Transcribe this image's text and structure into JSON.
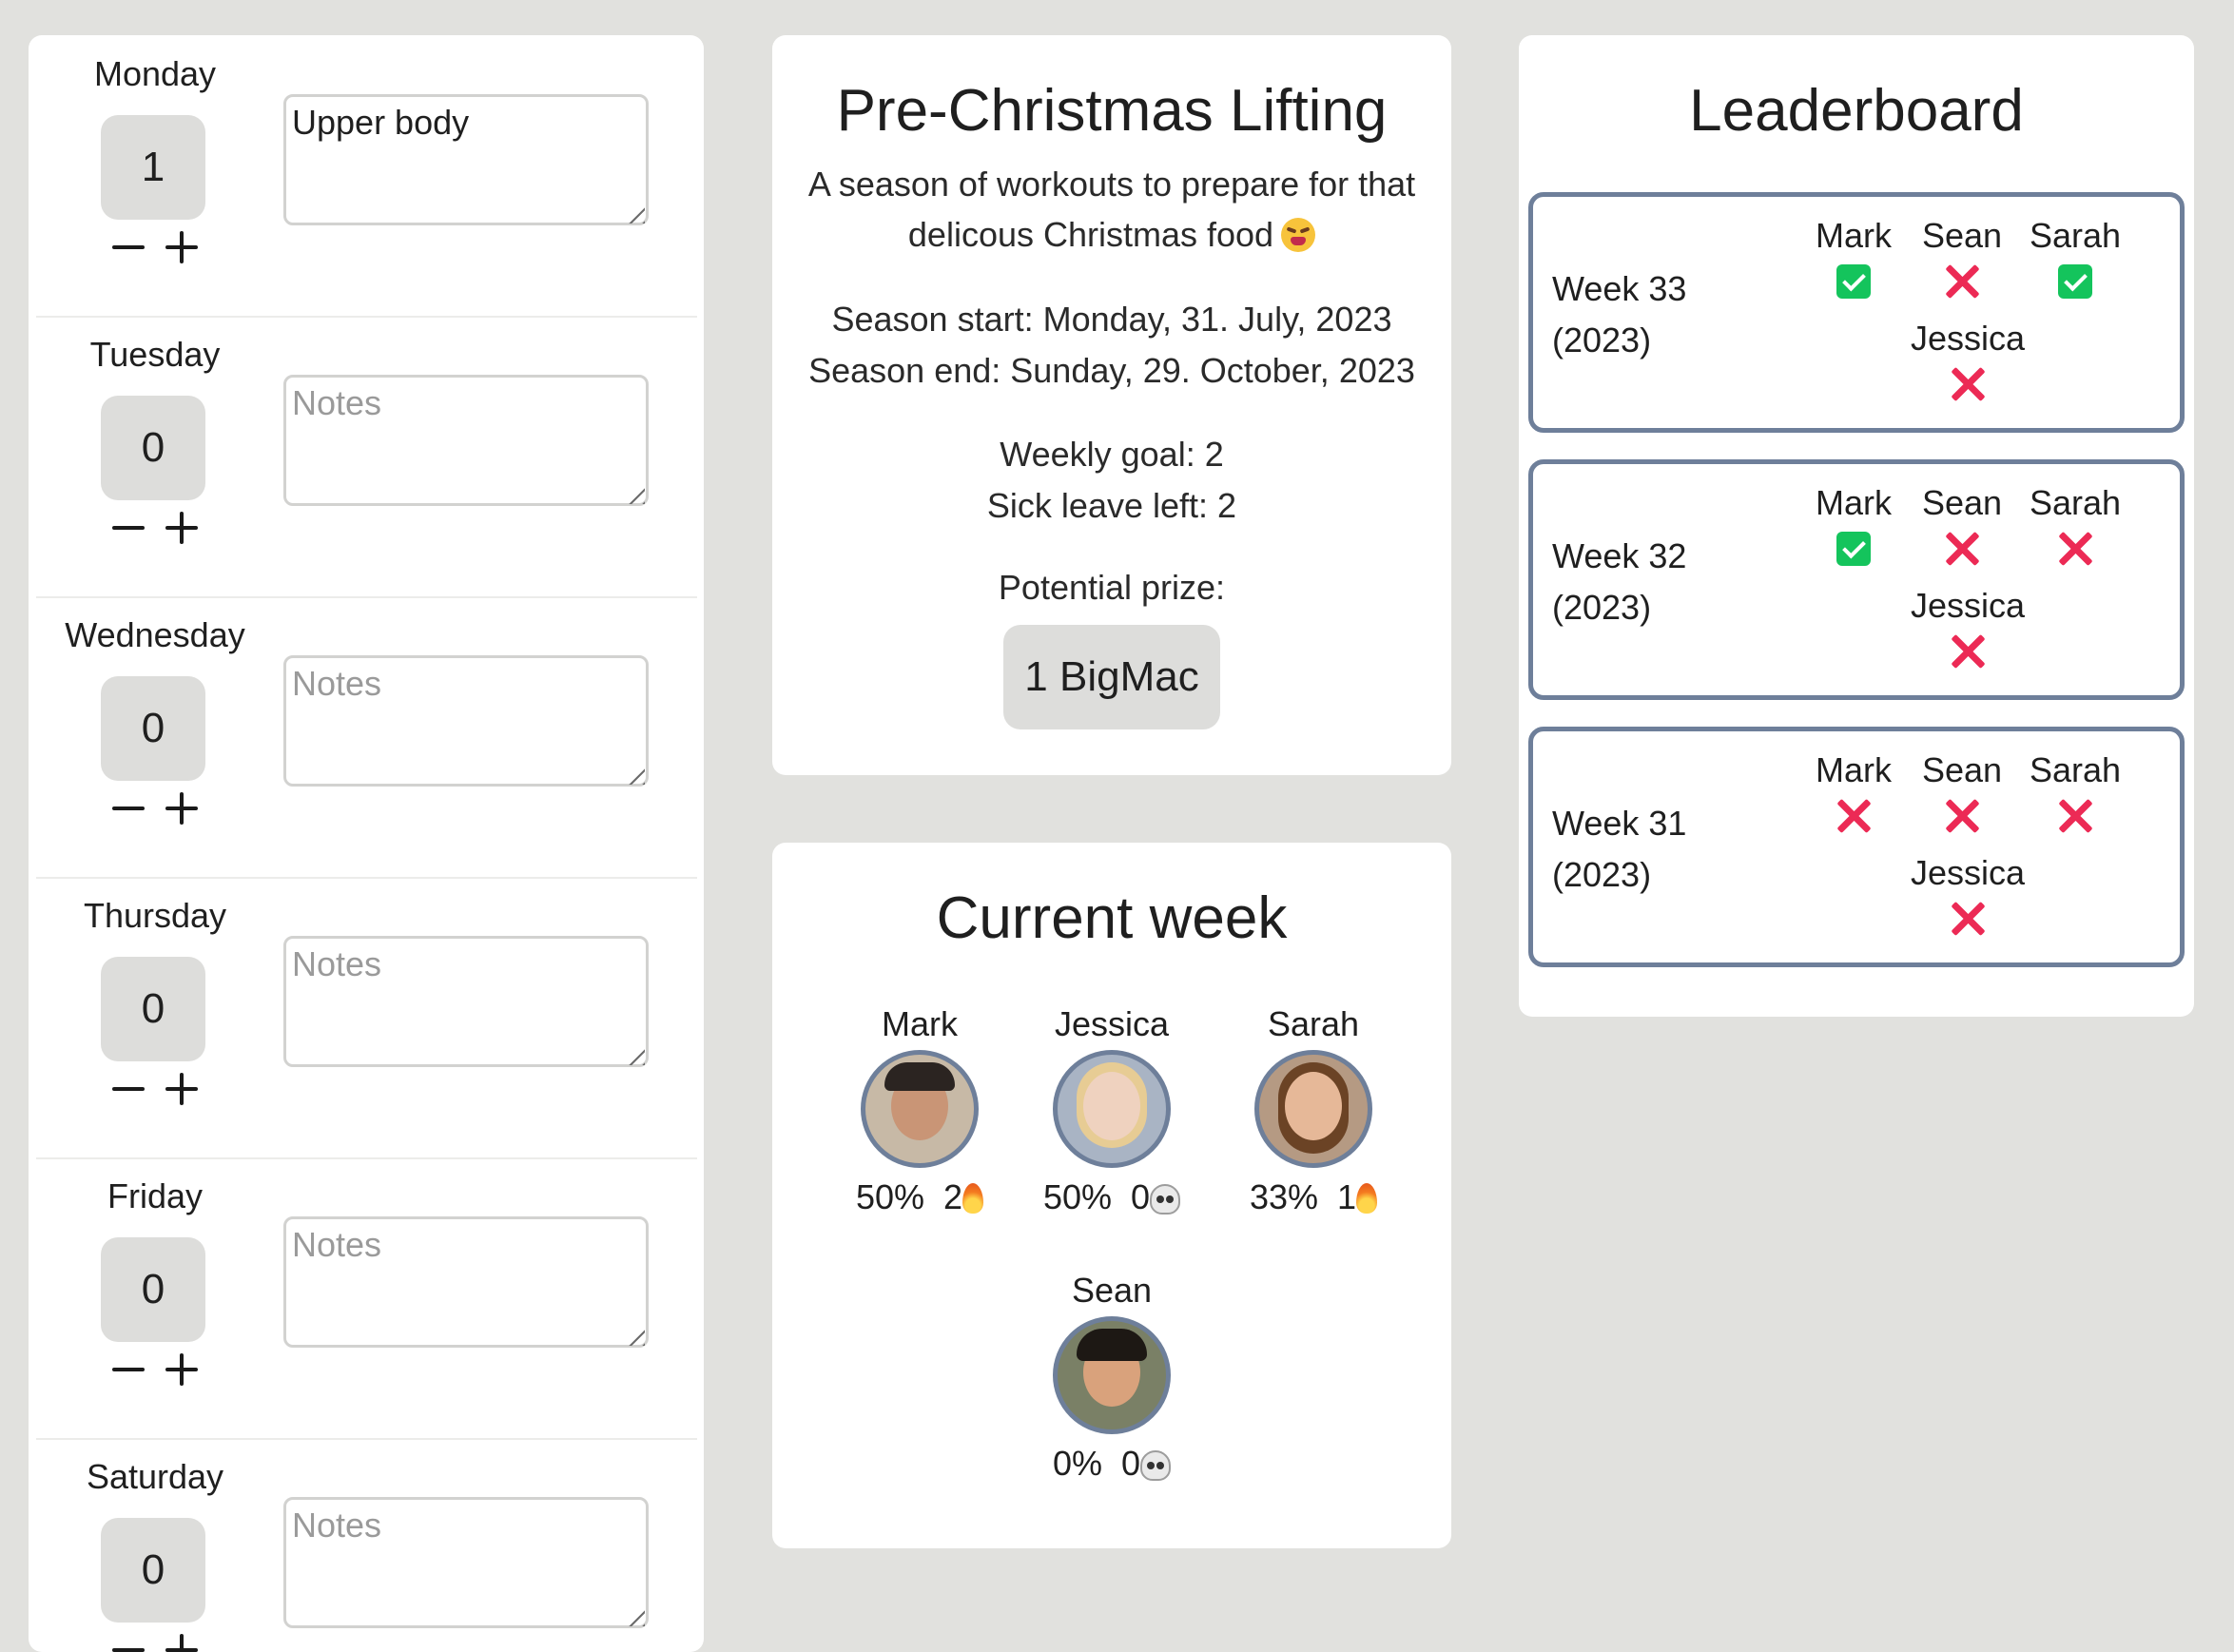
{
  "days": [
    {
      "name": "Monday",
      "count": "1",
      "notes_value": "Upper body",
      "notes_placeholder": "Notes"
    },
    {
      "name": "Tuesday",
      "count": "0",
      "notes_value": "",
      "notes_placeholder": "Notes"
    },
    {
      "name": "Wednesday",
      "count": "0",
      "notes_value": "",
      "notes_placeholder": "Notes"
    },
    {
      "name": "Thursday",
      "count": "0",
      "notes_value": "",
      "notes_placeholder": "Notes"
    },
    {
      "name": "Friday",
      "count": "0",
      "notes_value": "",
      "notes_placeholder": "Notes"
    },
    {
      "name": "Saturday",
      "count": "0",
      "notes_value": "",
      "notes_placeholder": "Notes"
    }
  ],
  "season": {
    "title": "Pre-Christmas Lifting",
    "description": "A season of workouts to prepare for that delicous Christmas food",
    "start": "Season start: Monday, 31. July, 2023",
    "end": "Season end: Sunday, 29. October, 2023",
    "weekly_goal_label": "Weekly goal: ",
    "weekly_goal_value": "2",
    "sick_leave_label": "Sick leave left: ",
    "sick_leave_value": "2",
    "prize_label": "Potential prize:",
    "prize_value": "1 BigMac"
  },
  "current_week": {
    "title": "Current week",
    "members": [
      {
        "name": "Mark",
        "percent": "50%",
        "streak": "2",
        "streak_icon": "flame-icon",
        "progress": 0.5
      },
      {
        "name": "Jessica",
        "percent": "50%",
        "streak": "0",
        "streak_icon": "skull-icon",
        "progress": 0.5
      },
      {
        "name": "Sarah",
        "percent": "33%",
        "streak": "1",
        "streak_icon": "flame-icon",
        "progress": 0.33
      },
      {
        "name": "Sean",
        "percent": "0%",
        "streak": "0",
        "streak_icon": "skull-icon",
        "progress": 0.0
      }
    ]
  },
  "leaderboard": {
    "title": "Leaderboard",
    "weeks": [
      {
        "week": "Week 33",
        "year": "(2023)",
        "results": [
          {
            "name": "Mark",
            "done": true
          },
          {
            "name": "Sean",
            "done": false
          },
          {
            "name": "Sarah",
            "done": true
          },
          {
            "name": "Jessica",
            "done": false
          }
        ]
      },
      {
        "week": "Week 32",
        "year": "(2023)",
        "results": [
          {
            "name": "Mark",
            "done": true
          },
          {
            "name": "Sean",
            "done": false
          },
          {
            "name": "Sarah",
            "done": false
          },
          {
            "name": "Jessica",
            "done": false
          }
        ]
      },
      {
        "week": "Week 31",
        "year": "(2023)",
        "results": [
          {
            "name": "Mark",
            "done": false
          },
          {
            "name": "Sean",
            "done": false
          },
          {
            "name": "Sarah",
            "done": false
          },
          {
            "name": "Jessica",
            "done": false
          }
        ]
      }
    ]
  },
  "colors": {
    "background": "#e1e1de",
    "accent_border": "#6e7f9a",
    "done": "#14c45c",
    "missed": "#ec2a55"
  }
}
